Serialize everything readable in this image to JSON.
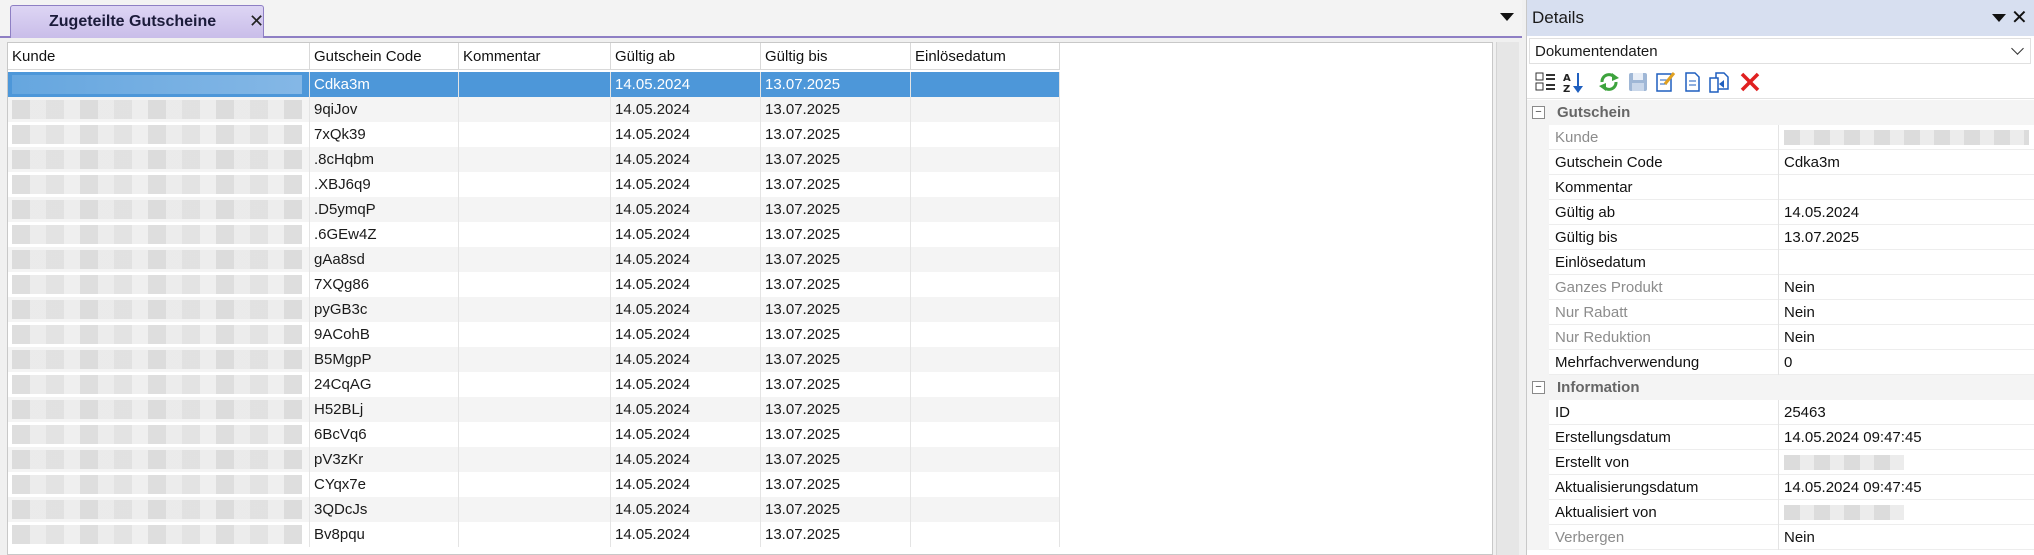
{
  "tab": {
    "label": "Zugeteilte Gutscheine",
    "close": "✕"
  },
  "grid": {
    "columns": [
      {
        "key": "kunde",
        "label": "Kunde"
      },
      {
        "key": "code",
        "label": "Gutschein Code"
      },
      {
        "key": "kommentar",
        "label": "Kommentar"
      },
      {
        "key": "ab",
        "label": "Gültig ab"
      },
      {
        "key": "bis",
        "label": "Gültig bis"
      },
      {
        "key": "einloese",
        "label": "Einlösedatum"
      }
    ],
    "rows": [
      {
        "code": "Cdka3m",
        "ab": "14.05.2024",
        "bis": "13.07.2025"
      },
      {
        "code": "9qiJov",
        "ab": "14.05.2024",
        "bis": "13.07.2025"
      },
      {
        "code": "7xQk39",
        "ab": "14.05.2024",
        "bis": "13.07.2025"
      },
      {
        "code": ".8cHqbm",
        "ab": "14.05.2024",
        "bis": "13.07.2025"
      },
      {
        "code": ".XBJ6q9",
        "ab": "14.05.2024",
        "bis": "13.07.2025"
      },
      {
        "code": ".D5ymqP",
        "ab": "14.05.2024",
        "bis": "13.07.2025"
      },
      {
        "code": ".6GEw4Z",
        "ab": "14.05.2024",
        "bis": "13.07.2025"
      },
      {
        "code": "gAa8sd",
        "ab": "14.05.2024",
        "bis": "13.07.2025"
      },
      {
        "code": "7XQg86",
        "ab": "14.05.2024",
        "bis": "13.07.2025"
      },
      {
        "code": "pyGB3c",
        "ab": "14.05.2024",
        "bis": "13.07.2025"
      },
      {
        "code": "9ACohB",
        "ab": "14.05.2024",
        "bis": "13.07.2025"
      },
      {
        "code": "B5MgpP",
        "ab": "14.05.2024",
        "bis": "13.07.2025"
      },
      {
        "code": "24CqAG",
        "ab": "14.05.2024",
        "bis": "13.07.2025"
      },
      {
        "code": "H52BLj",
        "ab": "14.05.2024",
        "bis": "13.07.2025"
      },
      {
        "code": "6BcVq6",
        "ab": "14.05.2024",
        "bis": "13.07.2025"
      },
      {
        "code": "pV3zKr",
        "ab": "14.05.2024",
        "bis": "13.07.2025"
      },
      {
        "code": "CYqx7e",
        "ab": "14.05.2024",
        "bis": "13.07.2025"
      },
      {
        "code": "3QDcJs",
        "ab": "14.05.2024",
        "bis": "13.07.2025"
      },
      {
        "code": "Bv8pqu",
        "ab": "14.05.2024",
        "bis": "13.07.2025"
      }
    ]
  },
  "details": {
    "title": "Details",
    "close": "✕",
    "combo_value": "Dokumentendaten",
    "toolbar_icons": [
      "categorized-icon",
      "sort-az-icon",
      "refresh-icon",
      "save-icon",
      "edit-document-icon",
      "document-icon",
      "copy-document-icon",
      "delete-icon"
    ],
    "categories": [
      {
        "label": "Gutschein",
        "toggle": "−",
        "props": [
          {
            "name": "Kunde",
            "value": "",
            "dim": true,
            "blurred": true
          },
          {
            "name": "Gutschein Code",
            "value": "Cdka3m",
            "dim": false
          },
          {
            "name": "Kommentar",
            "value": "",
            "dim": false
          },
          {
            "name": "Gültig ab",
            "value": "14.05.2024",
            "dim": false
          },
          {
            "name": "Gültig bis",
            "value": "13.07.2025",
            "dim": false
          },
          {
            "name": "Einlösedatum",
            "value": "",
            "dim": false
          },
          {
            "name": "Ganzes Produkt",
            "value": "Nein",
            "dim": true
          },
          {
            "name": "Nur Rabatt",
            "value": "Nein",
            "dim": true
          },
          {
            "name": "Nur Reduktion",
            "value": "Nein",
            "dim": true
          },
          {
            "name": "Mehrfachverwendung",
            "value": "0",
            "dim": false
          }
        ]
      },
      {
        "label": "Information",
        "toggle": "−",
        "props": [
          {
            "name": "ID",
            "value": "25463",
            "dim": false
          },
          {
            "name": "Erstellungsdatum",
            "value": "14.05.2024 09:47:45",
            "dim": false
          },
          {
            "name": "Erstellt von",
            "value": "",
            "dim": false,
            "blurred": true
          },
          {
            "name": "Aktualisierungsdatum",
            "value": "14.05.2024 09:47:45",
            "dim": false
          },
          {
            "name": "Aktualisiert von",
            "value": "",
            "dim": false,
            "blurred": true
          },
          {
            "name": "Verbergen",
            "value": "Nein",
            "dim": true
          }
        ]
      }
    ]
  },
  "colors": {
    "selection": "#4d97d9",
    "tab": "#c9bde9",
    "panel_header": "#d7dff0"
  }
}
